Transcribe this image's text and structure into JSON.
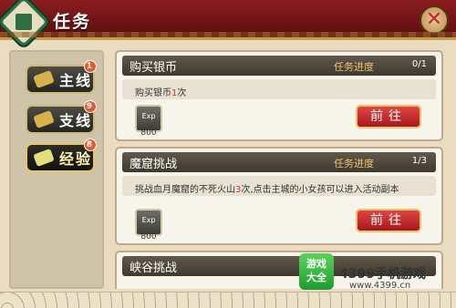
{
  "header": {
    "title": "任务"
  },
  "tabs": [
    {
      "label": "主线",
      "badge": "1"
    },
    {
      "label": "支线",
      "badge": "9"
    },
    {
      "label": "经验",
      "badge": "8",
      "active": true
    }
  ],
  "quests": [
    {
      "title": "购买银币",
      "progress_label": "任务进度",
      "progress": "0/1",
      "desc_before": "购买银币",
      "desc_highlight": "1",
      "desc_after": "次",
      "exp_label": "Exp",
      "exp": "800",
      "go_label": "前往"
    },
    {
      "title": "魔窟挑战",
      "progress_label": "任务进度",
      "progress": "1/3",
      "desc_before": "挑战血月魔窟的不死火山",
      "desc_highlight": "3",
      "desc_after": "次,点击主城的小女孩可以进入活动副本",
      "exp_label": "Exp",
      "exp": "800",
      "go_label": "前往"
    },
    {
      "title": "峡谷挑战"
    }
  ],
  "watermark": {
    "badge_line1": "游戏",
    "badge_line2": "大全",
    "brand": "4399手机游戏",
    "site": "www.4399.cn"
  }
}
